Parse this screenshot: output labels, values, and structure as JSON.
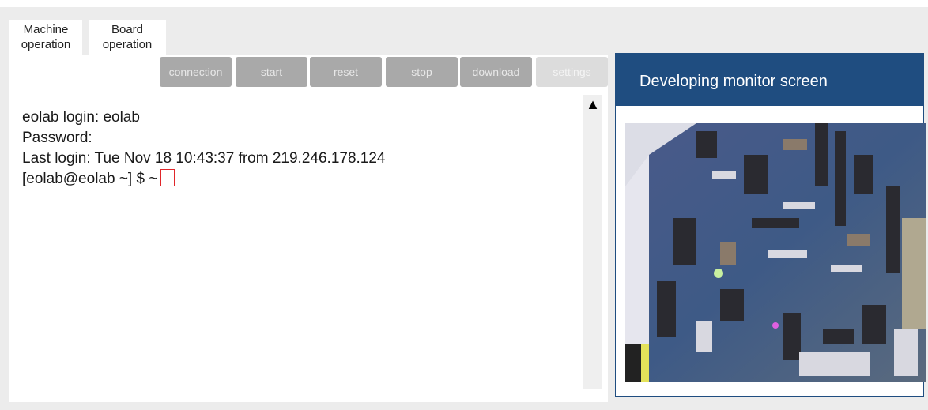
{
  "tabs": [
    {
      "line1": "Machine",
      "line2": "operation"
    },
    {
      "line1": "Board",
      "line2": "operation"
    }
  ],
  "toolbar": {
    "buttons": [
      "connection",
      "start",
      "reset",
      "stop",
      "download",
      "settings"
    ]
  },
  "terminal": {
    "lines": [
      "eolab login: eolab",
      "Password:",
      "Last login: Tue Nov 18 10:43:37 from 219.246.178.124"
    ],
    "prompt": "[eolab@eolab ~] $ ~"
  },
  "scrollbar": {
    "up_arrow": "▲"
  },
  "monitor": {
    "title": "Developing monitor screen",
    "image_subject": "circuit-board-camera-feed"
  },
  "colors": {
    "header_blue": "#1f4d80",
    "button_gray": "#a9a9a9",
    "cursor_red": "#e0262a"
  }
}
